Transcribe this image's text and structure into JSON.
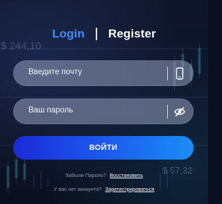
{
  "background": {
    "ticker_top": "$ 244,10",
    "ticker_bottom": "$ 57,32"
  },
  "tabs": {
    "login": "Login",
    "register": "Register",
    "active": "login"
  },
  "email": {
    "placeholder": "Введите почту",
    "icon": "phone-icon"
  },
  "password": {
    "placeholder": "Ваш пароль",
    "icon": "eye-slash-icon"
  },
  "submit_label": "ВОЙТИ",
  "forgot": {
    "text": "Забыли Пароль?",
    "link": "Восстановить"
  },
  "signup": {
    "text": "У вас нет аккаунта?",
    "link": "Зарегистрироваться"
  },
  "colors": {
    "accent": "#3d8ff5",
    "button_start": "#1a2bd6",
    "button_end": "#1b8ef3",
    "background": "#0b1020"
  }
}
